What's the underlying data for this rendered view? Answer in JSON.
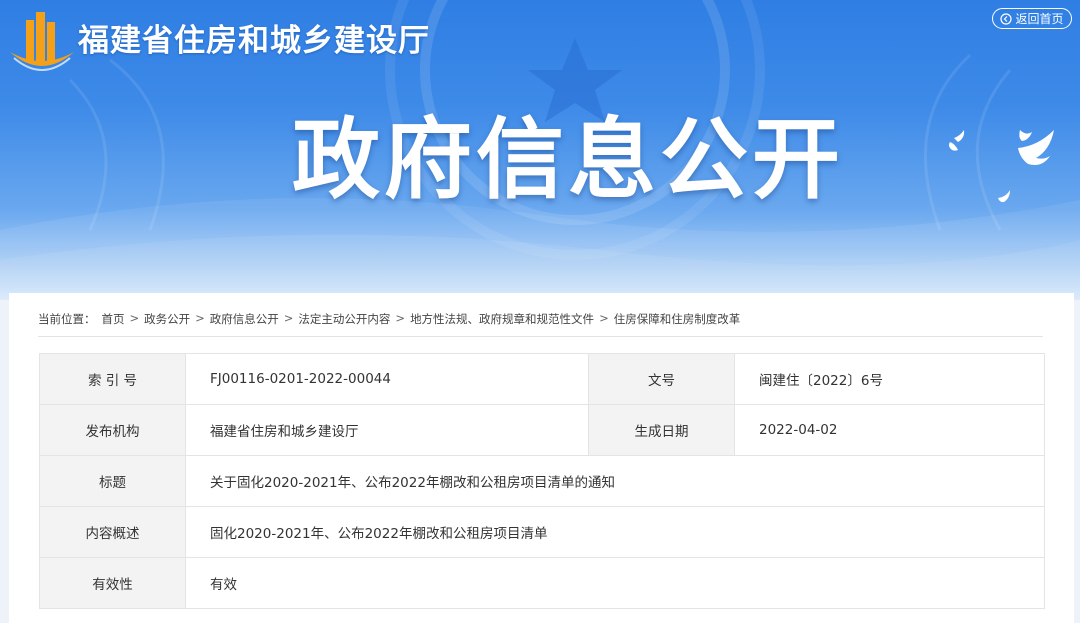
{
  "header": {
    "site_name": "福建省住房和城乡建设厅",
    "home_button": "返回首页",
    "banner_title": "政府信息公开"
  },
  "breadcrumb": {
    "prefix": "当前位置：",
    "items": [
      "首页",
      "政务公开",
      "政府信息公开",
      "法定主动公开内容",
      "地方性法规、政府规章和规范性文件",
      "住房保障和住房制度改革"
    ],
    "separator": ">"
  },
  "info_table": {
    "index_label": "索 引 号",
    "index_value": "FJ00116-0201-2022-00044",
    "doc_no_label": "文号",
    "doc_no_value": "闽建住〔2022〕6号",
    "publisher_label": "发布机构",
    "publisher_value": "福建省住房和城乡建设厅",
    "date_label": "生成日期",
    "date_value": "2022-04-02",
    "title_label": "标题",
    "title_value": "关于固化2020-2021年、公布2022年棚改和公租房项目清单的通知",
    "summary_label": "内容概述",
    "summary_value": "固化2020-2021年、公布2022年棚改和公租房项目清单",
    "validity_label": "有效性",
    "validity_value": "有效"
  },
  "icons": {
    "logo": "building-logo-icon",
    "home": "home-icon",
    "decor": "star-emblem-icon",
    "birds": "dove-icon"
  },
  "colors": {
    "banner_top": "#2f7ee3",
    "banner_bottom": "#d6e8fb",
    "logo_orange": "#f5a019"
  }
}
